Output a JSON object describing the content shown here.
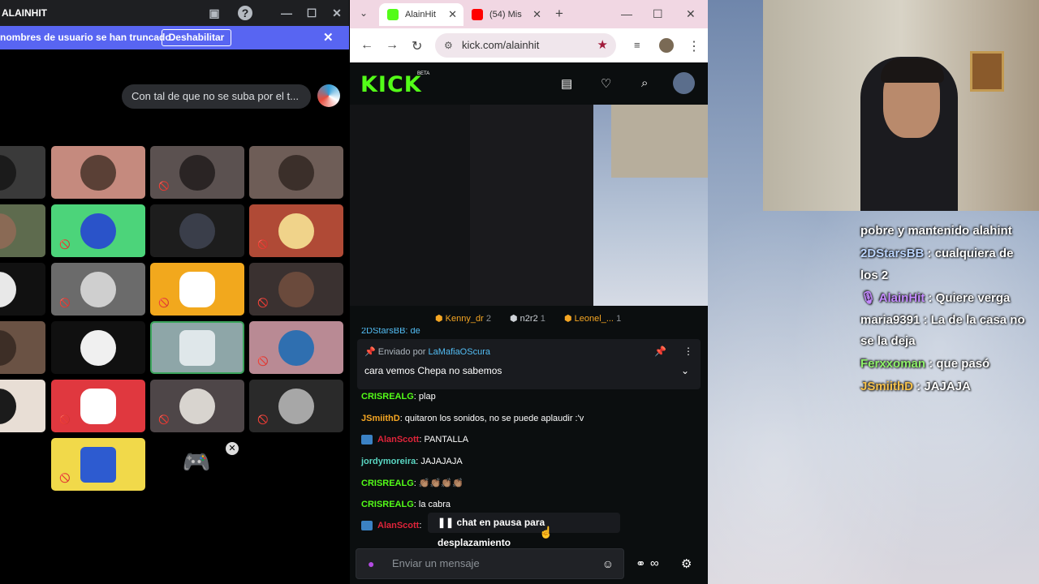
{
  "discord": {
    "title": "ALAINHIT",
    "banner": {
      "message": "nombres de usuario se han truncado.",
      "button": "Deshabilitar"
    },
    "message_preview": "Con tal de que no se suba por el t..."
  },
  "browser": {
    "tabs": [
      {
        "label": "AlainHit",
        "active": true
      },
      {
        "label": "(54) Mis",
        "active": false
      }
    ],
    "url": "kick.com/alainhit"
  },
  "kick": {
    "logo": "KICK",
    "beta": "BETA",
    "contributors": [
      {
        "name": "Kenny_dr",
        "count": "2",
        "color": "#f5a623"
      },
      {
        "name": "n2r2",
        "count": "1",
        "color": "#cfd3d8"
      },
      {
        "name": "Leonel_...",
        "count": "1",
        "color": "#f5a623"
      }
    ],
    "partial_top_user": "2DStarsBB: de",
    "pinned": {
      "label": "Enviado por",
      "user": "LaMafiaOScura",
      "message": "cara vemos Chepa no sabemos"
    },
    "chat": [
      {
        "user": "CRISREALG",
        "color": "#53fc18",
        "text": ": plap",
        "badge": false
      },
      {
        "user": "JSmiithD",
        "color": "#f5a623",
        "text": ": quitaron los sonidos, no se puede aplaudir :'v",
        "badge": false
      },
      {
        "user": "AlanScott",
        "color": "#e0243a",
        "text": ": PANTALLA",
        "badge": true
      },
      {
        "user": "jordymoreira",
        "color": "#5ad7c3",
        "text": ": JAJAJAJA",
        "badge": false
      },
      {
        "user": "CRISREALG",
        "color": "#53fc18",
        "text": ": 👏🏽👏🏽👏🏽👏🏽",
        "badge": false
      },
      {
        "user": "CRISREALG",
        "color": "#53fc18",
        "text": ": la cabra",
        "badge": false
      },
      {
        "user": "AlanScott",
        "color": "#e0243a",
        "text": ":",
        "badge": true
      }
    ],
    "pause_notice": "chat en pausa para desplazamiento",
    "input_placeholder": "Enviar un mensaje"
  },
  "overlay_chat": [
    {
      "user": "",
      "text": "pobre y mantenido alahint",
      "color": "#ffffff"
    },
    {
      "user": "2DStarsBB",
      "text": " : cualquiera de",
      "color": "#bcd6ff"
    },
    {
      "user": "",
      "text": "los 2",
      "color": "#ffffff"
    },
    {
      "user": "AlainHit",
      "text": " : Quiere verga",
      "color": "#c48bff"
    },
    {
      "user": "maria9391",
      "text": " : La de la casa no",
      "color": "#ffffff"
    },
    {
      "user": "",
      "text": "se la deja",
      "color": "#ffffff"
    },
    {
      "user": "Ferxxoman",
      "text": " : que pasó",
      "color": "#8ef06a"
    },
    {
      "user": "JSmiithD",
      "text": " : JAJAJA",
      "color": "#f5c14d"
    }
  ]
}
